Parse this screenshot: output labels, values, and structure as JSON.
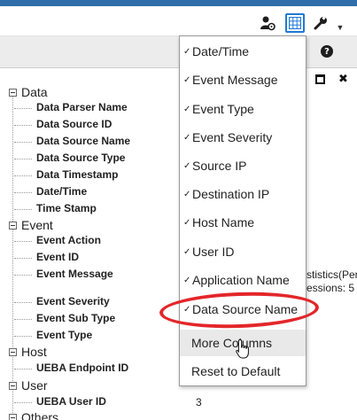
{
  "toolbar": {
    "icons": [
      "user-settings-icon",
      "grid-columns-icon",
      "wrench-icon",
      "chevron-down-icon"
    ],
    "accent_color": "#1f7ad6",
    "brand_color": "#2f6ea8"
  },
  "panel": {
    "help_glyph": "?",
    "maximize_icon": "maximize-icon",
    "close_glyph": "✖"
  },
  "tree": {
    "categories": [
      {
        "label": "Data",
        "fields": [
          "Data Parser Name",
          "Data Source ID",
          "Data Source Name",
          "Data Source Type",
          "Data Timestamp",
          "Date/Time",
          "Time Stamp"
        ]
      },
      {
        "label": "Event",
        "fields": [
          "Event Action",
          "Event ID",
          "Event Message",
          "Event Severity",
          "Event Sub Type",
          "Event Type"
        ]
      },
      {
        "label": "Host",
        "fields": [
          "UEBA Endpoint ID"
        ]
      },
      {
        "label": "User",
        "fields": [
          "UEBA User ID"
        ]
      },
      {
        "label": "Others",
        "fields": []
      }
    ],
    "partial_values": {
      "event_message_line1": "stistics(Perfo",
      "event_message_line2": "essions:  5",
      "ueba_user_id": "3"
    }
  },
  "menu": {
    "check_glyph": "✓",
    "items": [
      {
        "label": "Date/Time",
        "checked": true
      },
      {
        "label": "Event Message",
        "checked": true
      },
      {
        "label": "Event Type",
        "checked": true
      },
      {
        "label": "Event Severity",
        "checked": true
      },
      {
        "label": "Source IP",
        "checked": true
      },
      {
        "label": "Destination IP",
        "checked": true
      },
      {
        "label": "Host Name",
        "checked": true
      },
      {
        "label": "User ID",
        "checked": true
      },
      {
        "label": "Application Name",
        "checked": true
      },
      {
        "label": "Data Source Name",
        "checked": true
      },
      {
        "label": "More Columns",
        "checked": false
      },
      {
        "label": "Reset to Default",
        "checked": false
      }
    ],
    "highlight_color": "#e3262a"
  }
}
